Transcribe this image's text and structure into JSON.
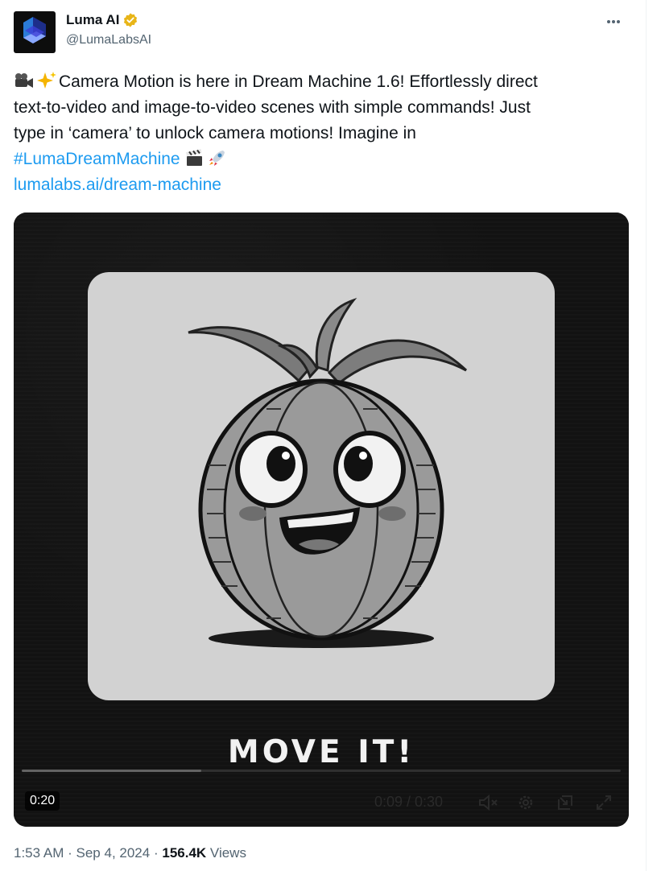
{
  "author": {
    "display_name": "Luma AI",
    "handle": "@LumaLabsAI",
    "verified_icon": "verified-badge-icon",
    "avatar_icon": "luma-logo-icon"
  },
  "tweet": {
    "line1_text": "Camera Motion is here in Dream Machine 1.6! Effortlessly direct",
    "line2_text": "text-to-video and image-to-video scenes with simple commands! Just",
    "line3_text": "type in ‘camera’ to unlock camera motions! Imagine in",
    "hashtag": "#LumaDreamMachine",
    "link": "lumalabs.ai/dream-machine",
    "emojis": [
      "movie-camera",
      "sparkles",
      "clapper-board",
      "rocket"
    ]
  },
  "video": {
    "caption": "MOVE IT!",
    "duration_badge": "0:20",
    "time_readout": "0:09 / 0:30",
    "progress": 0.3,
    "controls": [
      "mute-icon",
      "settings-icon",
      "pip-icon",
      "fullscreen-icon"
    ]
  },
  "meta": {
    "time": "1:53 AM",
    "date": "Sep 4, 2024",
    "views_count": "156.4K",
    "views_label": "Views",
    "separator": "·"
  },
  "colors": {
    "link": "#1d9bf0",
    "text": "#0f1419",
    "secondary": "#536471",
    "verified": "#e8b518"
  }
}
